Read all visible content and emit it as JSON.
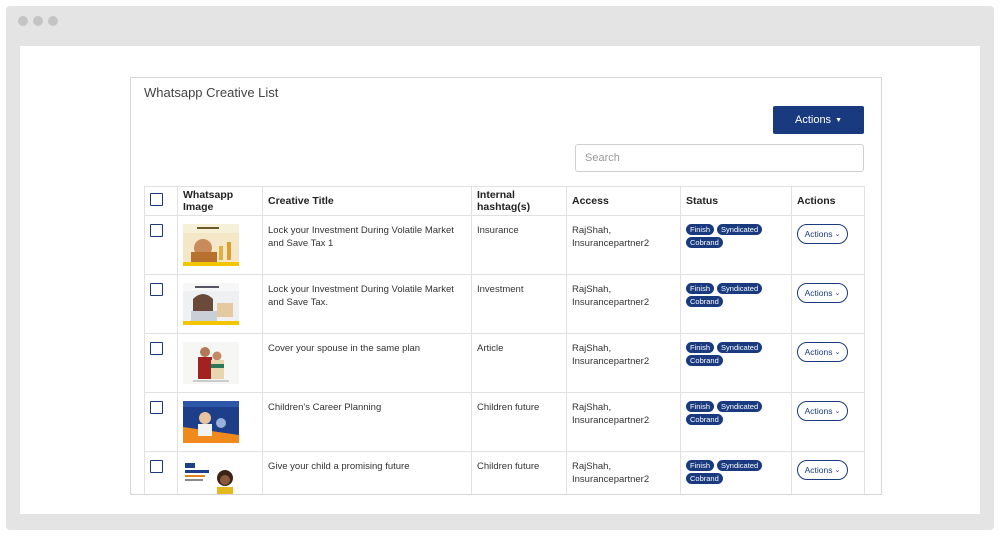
{
  "panel": {
    "title": "Whatsapp Creative List",
    "actions_label": "Actions",
    "search_placeholder": "Search"
  },
  "table": {
    "headers": {
      "image": "Whatsapp Image",
      "title": "Creative Title",
      "hashtags": "Internal hashtag(s)",
      "access": "Access",
      "status": "Status",
      "actions": "Actions"
    },
    "rows": [
      {
        "title": "Lock your Investment During Volatile Market and Save Tax 1",
        "hashtag": "Insurance",
        "access_1": "RajShah,",
        "access_2": "Insurancepartner2",
        "badges": [
          "Finish",
          "Syndicated",
          "Cobrand"
        ],
        "action_label": "Actions"
      },
      {
        "title": "Lock your Investment During Volatile Market and Save Tax.",
        "hashtag": "Investment",
        "access_1": "RajShah,",
        "access_2": "Insurancepartner2",
        "badges": [
          "Finish",
          "Syndicated",
          "Cobrand"
        ],
        "action_label": "Actions"
      },
      {
        "title": "Cover your spouse in the same plan",
        "hashtag": "Article",
        "access_1": "RajShah,",
        "access_2": "Insurancepartner2",
        "badges": [
          "Finish",
          "Syndicated",
          "Cobrand"
        ],
        "action_label": "Actions"
      },
      {
        "title": "Children's Career Planning",
        "hashtag": "Children future",
        "access_1": "RajShah,",
        "access_2": "Insurancepartner2",
        "badges": [
          "Finish",
          "Syndicated",
          "Cobrand"
        ],
        "action_label": "Actions"
      },
      {
        "title": "Give your child a promising future",
        "hashtag": "Children future",
        "access_1": "RajShah,",
        "access_2": "Insurancepartner2",
        "badges": [
          "Finish",
          "Syndicated",
          "Cobrand"
        ],
        "action_label": "Actions"
      }
    ]
  },
  "colors": {
    "primary": "#1a3a7f",
    "frame": "#e4e4e4",
    "border": "#d6d6d6"
  }
}
